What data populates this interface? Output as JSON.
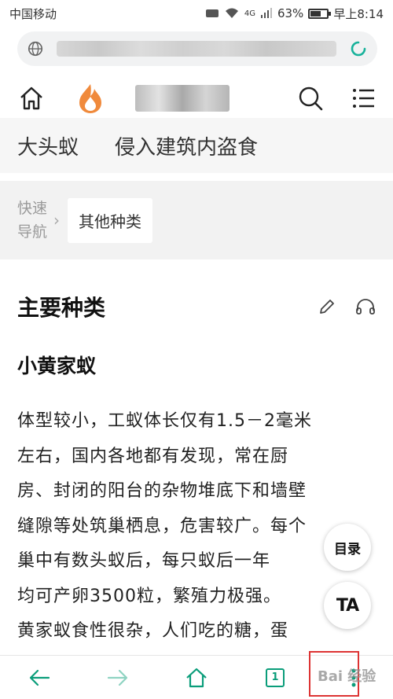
{
  "status": {
    "carrier": "中国移动",
    "signal": "4G",
    "battery": "63%",
    "battery_level": 0.63,
    "time": "早上8:14"
  },
  "toparticle": {
    "item1": "大头蚁",
    "item2": "侵入建筑内盗食"
  },
  "quicknav": {
    "label_line1": "快速",
    "label_line2": "导航",
    "chip": "其他种类"
  },
  "article": {
    "section_title": "主要种类",
    "sub_title": "小黄家蚁",
    "lines": [
      "体型较小，工蚁体长仅有1.5－2毫米",
      "左右，国内各地都有发现，常在厨",
      "房、封闭的阳台的杂物堆底下和墙壁",
      "缝隙等处筑巢栖息，危害较广。每个",
      "巢中有数头蚁后，每只蚁后一年",
      "均可产卵3500粒，繁殖力极强。",
      "黄家蚁食性很杂，人们吃的糖，蛋"
    ]
  },
  "fab": {
    "toc": "目录",
    "ta": "TA"
  },
  "bottom": {
    "tab_count": "1"
  },
  "colors": {
    "accent": "#0a9d7a",
    "highlight": "#d33333"
  },
  "watermark": "Bai 经验"
}
